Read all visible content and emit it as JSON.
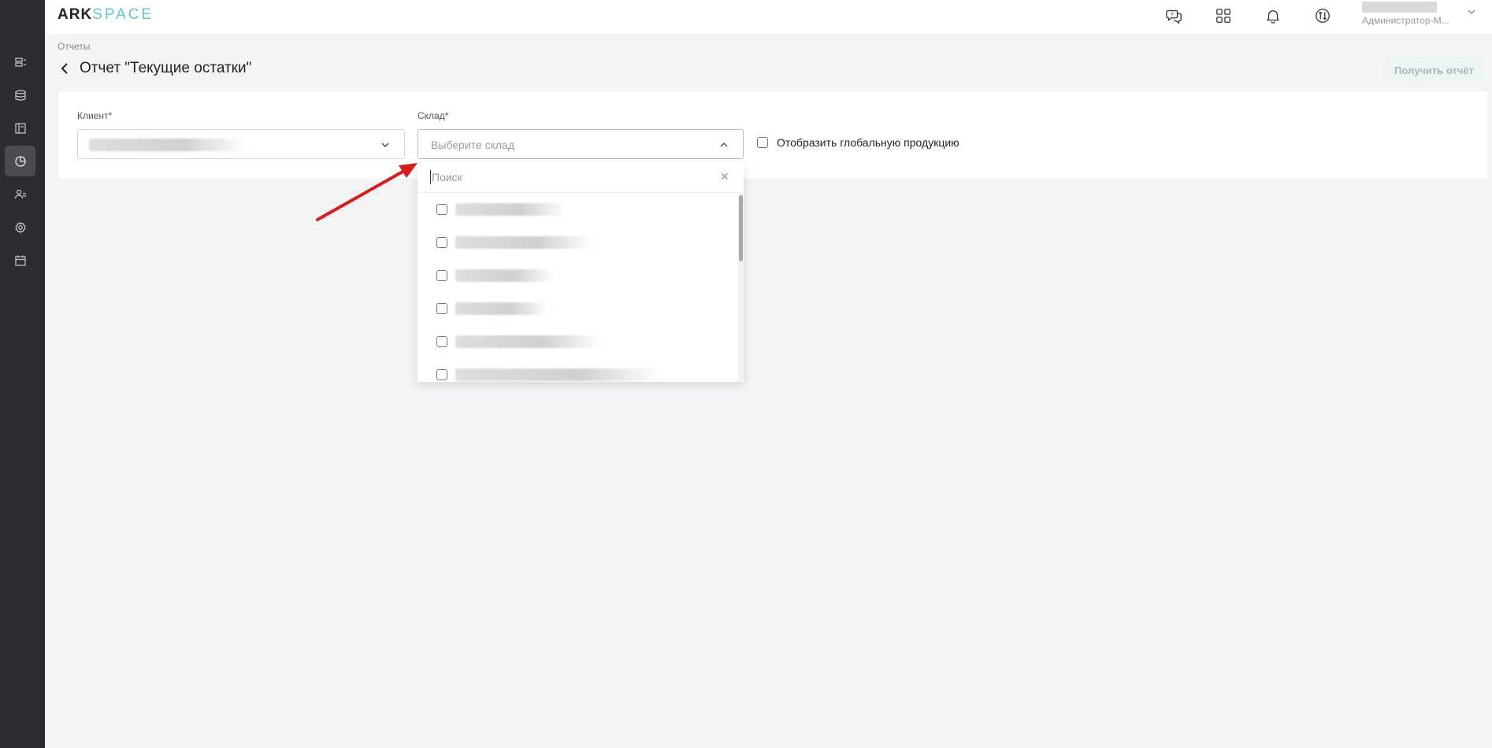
{
  "app": {
    "logo_ark": "ARK",
    "logo_space": "SPACE"
  },
  "topbar": {
    "icons": [
      "chat-help-icon",
      "apps-grid-icon",
      "bell-icon",
      "sync-icon"
    ],
    "user_role": "Администратор-М..."
  },
  "sidebar": {
    "items": [
      {
        "icon": "list-icon"
      },
      {
        "icon": "database-icon"
      },
      {
        "icon": "layout-icon"
      },
      {
        "icon": "pie-chart-icon",
        "active": true
      },
      {
        "icon": "users-icon"
      },
      {
        "icon": "gear-icon"
      },
      {
        "icon": "calendar-icon"
      }
    ]
  },
  "page": {
    "breadcrumb": "Отчеты",
    "title": "Отчет \"Текущие остатки\"",
    "get_report_label": "Получить отчёт"
  },
  "form": {
    "client_label": "Клиент*",
    "warehouse_label": "Склад*",
    "warehouse_placeholder": "Выберите склад",
    "global_products_label": "Отобразить глобальную продукцию"
  },
  "dropdown": {
    "search_placeholder": "Поиск",
    "option_count_visible": 6
  },
  "colors": {
    "sidebar_bg": "#2b2d31",
    "accent": "#5fc7d3",
    "annotation_arrow": "#d91c1c"
  }
}
